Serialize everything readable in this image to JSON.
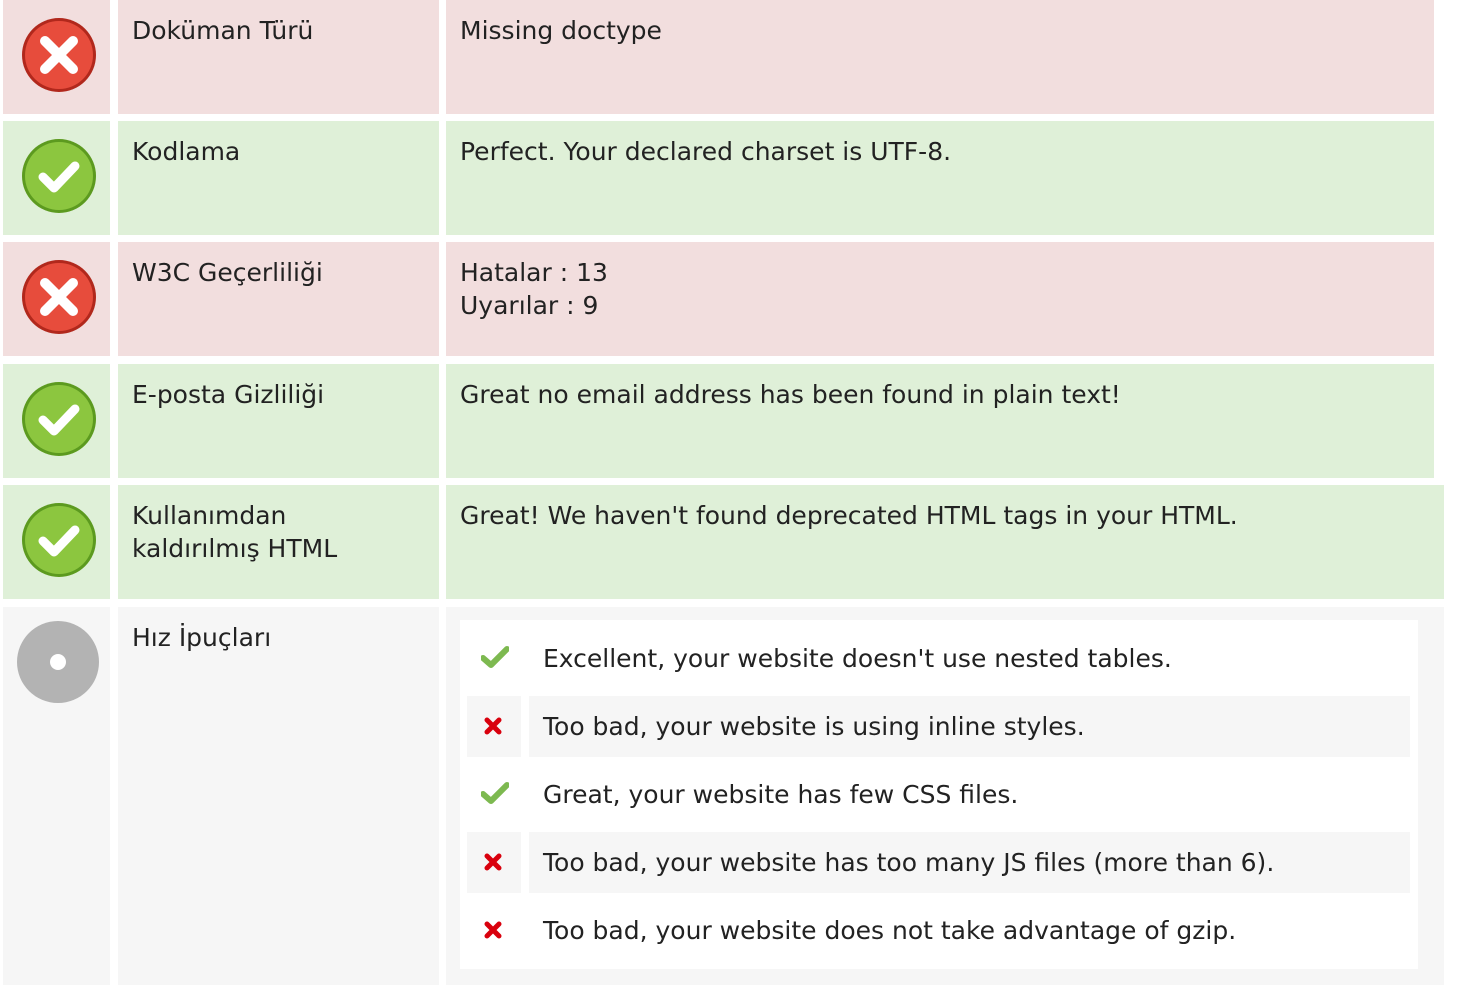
{
  "rows": [
    {
      "label": "Doküman Türü",
      "status": "error",
      "lines": [
        "Missing doctype"
      ]
    },
    {
      "label": "Kodlama",
      "status": "ok",
      "lines": [
        "Perfect. Your declared charset is UTF-8."
      ]
    },
    {
      "label": "W3C Geçerliliği",
      "status": "error",
      "lines": [
        "Hatalar : 13",
        "Uyarılar : 9"
      ]
    },
    {
      "label": "E-posta Gizliliği",
      "status": "ok",
      "lines": [
        "Great no email address has been found in plain text!"
      ]
    },
    {
      "label": "Kullanımdan kaldırılmış HTML",
      "status": "ok",
      "lines": [
        "Great! We haven't found deprecated HTML tags in your HTML."
      ]
    }
  ],
  "speed_tips": {
    "label": "Hız İpuçları",
    "status": "info",
    "items": [
      {
        "text": "Excellent, your website doesn't use nested tables.",
        "pass": true
      },
      {
        "text": "Too bad, your website is using inline styles.",
        "pass": false
      },
      {
        "text": "Great, your website has few CSS files.",
        "pass": true
      },
      {
        "text": "Too bad, your website has too many JS files (more than 6).",
        "pass": false
      },
      {
        "text": "Too bad, your website does not take advantage of gzip.",
        "pass": false
      }
    ]
  },
  "colors": {
    "error_bg": "#f2dede",
    "ok_bg": "#dff0d8",
    "neutral_bg": "#f6f6f6",
    "error_icon": "#e74c3c",
    "ok_icon": "#8cc63f",
    "info_icon": "#b3b3b3",
    "check_mark": "#7db950",
    "cross_mark": "#d9000d"
  },
  "icons": {
    "error": "error-circle-icon",
    "ok": "check-circle-icon",
    "info": "info-circle-icon",
    "pass": "checkmark-icon",
    "fail": "cross-icon"
  }
}
